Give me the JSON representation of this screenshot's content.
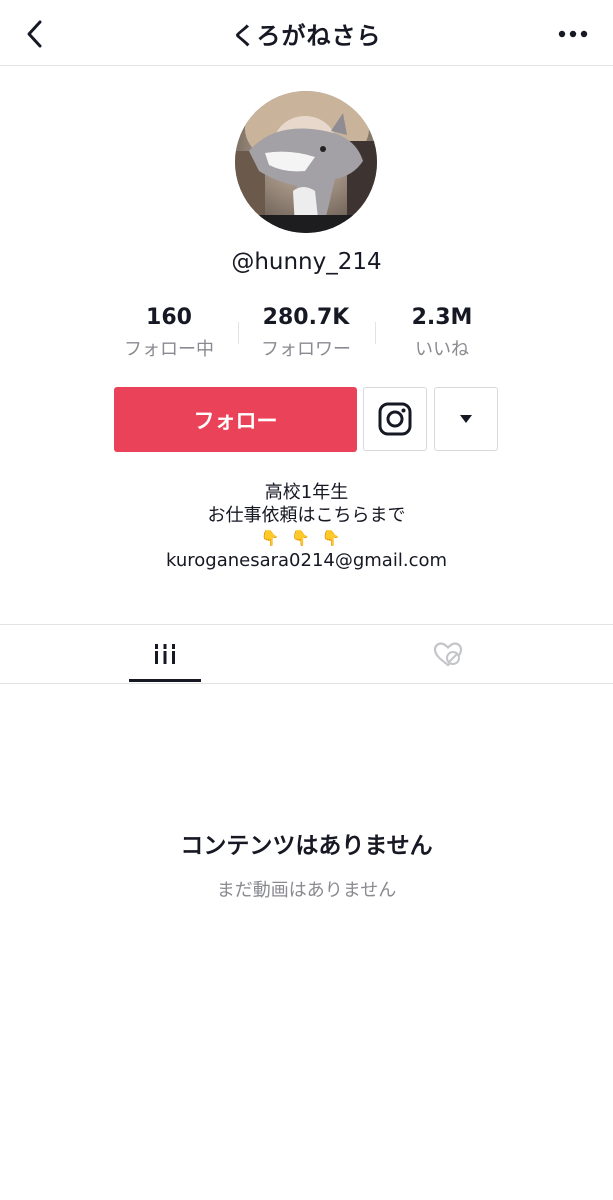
{
  "header": {
    "title": "くろがねさら",
    "back_icon": "chevron-left-icon",
    "more_icon": "more-horizontal-icon"
  },
  "profile": {
    "username": "@hunny_214",
    "avatar_alt": "avatar"
  },
  "stats": [
    {
      "value": "160",
      "label": "フォロー中"
    },
    {
      "value": "280.7K",
      "label": "フォロワー"
    },
    {
      "value": "2.3M",
      "label": "いいね"
    }
  ],
  "actions": {
    "follow_label": "フォロー",
    "follow_color": "#ea4359",
    "instagram_icon": "instagram-icon",
    "dropdown_icon": "caret-down-icon"
  },
  "bio": {
    "line1": "高校1年生",
    "line2": "お仕事依頼はこちらまで",
    "line3": "👇👇👇",
    "line4": "kuroganesara0214@gmail.com"
  },
  "tabs": {
    "videos_icon": "grid-bars-icon",
    "liked_icon": "heart-lock-icon"
  },
  "empty_state": {
    "title": "コンテンツはありません",
    "subtitle": "まだ動画はありません"
  }
}
